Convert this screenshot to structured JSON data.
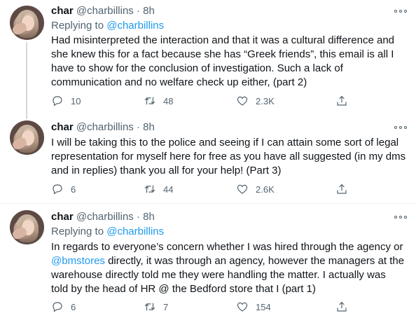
{
  "tweets": [
    {
      "name": "char",
      "handle": "@charbillins",
      "dot": "·",
      "time": "8h",
      "replying_prefix": "Replying to",
      "replying_to": "@charbillins",
      "lines": [
        "Had misinterpreted the interaction and that it was a cultural difference and",
        "she knew this for a fact because she has “Greek friends”, this email is all I",
        "have to show for the conclusion of investigation. Such a lack of",
        "communication and no welfare check up either, (part 2)"
      ],
      "replies": "10",
      "retweets": "48",
      "likes": "2.3K"
    },
    {
      "name": "char",
      "handle": "@charbillins",
      "dot": "·",
      "time": "8h",
      "lines": [
        "I will be taking this to the police and seeing if I can attain some sort of legal",
        "representation for myself here for free as you have all suggested (in my dms",
        "and in replies) thank you all for your help! (Part 3)"
      ],
      "replies": "6",
      "retweets": "44",
      "likes": "2.6K"
    },
    {
      "name": "char",
      "handle": "@charbillins",
      "dot": "·",
      "time": "8h",
      "replying_prefix": "Replying to",
      "replying_to": "@charbillins",
      "line1": "In regards to everyone’s concern whether I was hired through the agency or",
      "line2_mention": "@bmstores",
      "line2_rest": " directly, it was through an agency, however the managers at the",
      "line3": "warehouse directly told me they were handling the matter. I actually was",
      "line4": "told by the head of HR @ the Bedford store that I (part 1)",
      "replies": "6",
      "retweets": "7",
      "likes": "154"
    }
  ],
  "icons": [
    "more-icon",
    "reply-icon",
    "retweet-icon",
    "like-icon",
    "share-icon"
  ],
  "colors": {
    "link": "#1d9bf0",
    "secondary": "#536471",
    "text": "#0f1419",
    "thread_line": "#cfd9de"
  }
}
